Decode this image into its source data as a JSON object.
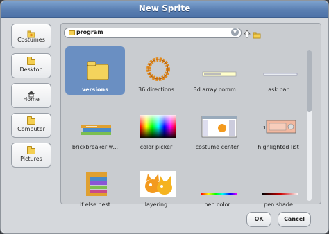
{
  "dialog": {
    "title": "New Sprite"
  },
  "sidebar": {
    "items": [
      {
        "label": "Costumes",
        "icon": "costumes-folder-icon"
      },
      {
        "label": "Desktop",
        "icon": "folder-icon"
      },
      {
        "label": "Home",
        "icon": "home-icon"
      },
      {
        "label": "Computer",
        "icon": "folder-icon"
      },
      {
        "label": "Pictures",
        "icon": "folder-icon"
      }
    ]
  },
  "path": {
    "current": "program"
  },
  "files": [
    {
      "name": "versions",
      "kind": "folder",
      "selected": true
    },
    {
      "name": "36 directions",
      "kind": "sprite"
    },
    {
      "name": "3d array comm...",
      "kind": "sprite"
    },
    {
      "name": "ask bar",
      "kind": "sprite"
    },
    {
      "name": "brickbreaker w...",
      "kind": "sprite"
    },
    {
      "name": "color picker",
      "kind": "sprite"
    },
    {
      "name": "costume center",
      "kind": "sprite"
    },
    {
      "name": "highlighted list",
      "kind": "sprite"
    },
    {
      "name": "if else nest",
      "kind": "sprite"
    },
    {
      "name": "layering",
      "kind": "sprite"
    },
    {
      "name": "pen color",
      "kind": "sprite"
    },
    {
      "name": "pen shade",
      "kind": "sprite"
    }
  ],
  "buttons": {
    "ok": "OK",
    "cancel": "Cancel"
  },
  "colors": {
    "title_bar": "#5a7fb2",
    "selection": "#6a8fc2",
    "folder": "#f4cf52"
  }
}
